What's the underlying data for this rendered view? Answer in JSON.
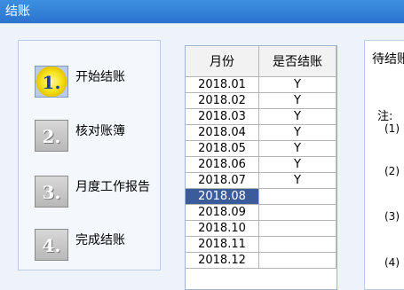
{
  "window": {
    "title": "结账"
  },
  "steps": [
    {
      "number": "1.",
      "label": "开始结账"
    },
    {
      "number": "2.",
      "label": "核对账簿"
    },
    {
      "number": "3.",
      "label": "月度工作报告"
    },
    {
      "number": "4.",
      "label": "完成结账"
    }
  ],
  "table": {
    "headers": [
      "月份",
      "是否结账"
    ],
    "rows": [
      {
        "month": "2018.01",
        "closed": "Y"
      },
      {
        "month": "2018.02",
        "closed": "Y"
      },
      {
        "month": "2018.03",
        "closed": "Y"
      },
      {
        "month": "2018.04",
        "closed": "Y"
      },
      {
        "month": "2018.05",
        "closed": "Y"
      },
      {
        "month": "2018.06",
        "closed": "Y"
      },
      {
        "month": "2018.07",
        "closed": "Y"
      },
      {
        "month": "2018.08",
        "closed": ""
      },
      {
        "month": "2018.09",
        "closed": ""
      },
      {
        "month": "2018.10",
        "closed": ""
      },
      {
        "month": "2018.11",
        "closed": ""
      },
      {
        "month": "2018.12",
        "closed": ""
      }
    ],
    "selected_month": "2018.08"
  },
  "right_panel": {
    "title": "待结账",
    "note_label": "注:",
    "items": [
      "(1)",
      "(2)",
      "(3)",
      "(4)"
    ]
  }
}
